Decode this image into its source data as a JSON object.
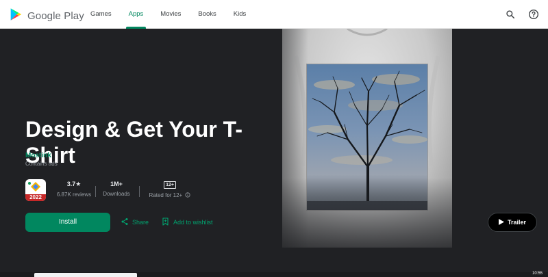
{
  "header": {
    "brand": "Google Play",
    "nav": [
      {
        "label": "Games",
        "active": false
      },
      {
        "label": "Apps",
        "active": true
      },
      {
        "label": "Movies",
        "active": false
      },
      {
        "label": "Books",
        "active": false
      },
      {
        "label": "Kids",
        "active": false
      }
    ],
    "icons": [
      "search-icon",
      "help-icon"
    ]
  },
  "app": {
    "title": "Design & Get Your T-Shirt",
    "developer": "Mostink",
    "ads_note": "Contains ads",
    "icon_badge": "2022",
    "rating": {
      "value": "3.7★",
      "label": "6.87K reviews"
    },
    "downloads": {
      "value": "1M+",
      "label": "Downloads"
    },
    "content_rating": {
      "badge": "12+",
      "label": "Rated for 12+"
    }
  },
  "actions": {
    "install": "Install",
    "share": "Share",
    "wishlist": "Add to wishlist",
    "trailer": "Trailer"
  },
  "taskbar": {
    "clock": "10:55"
  },
  "colors": {
    "accent": "#01875f",
    "background": "#202124"
  }
}
